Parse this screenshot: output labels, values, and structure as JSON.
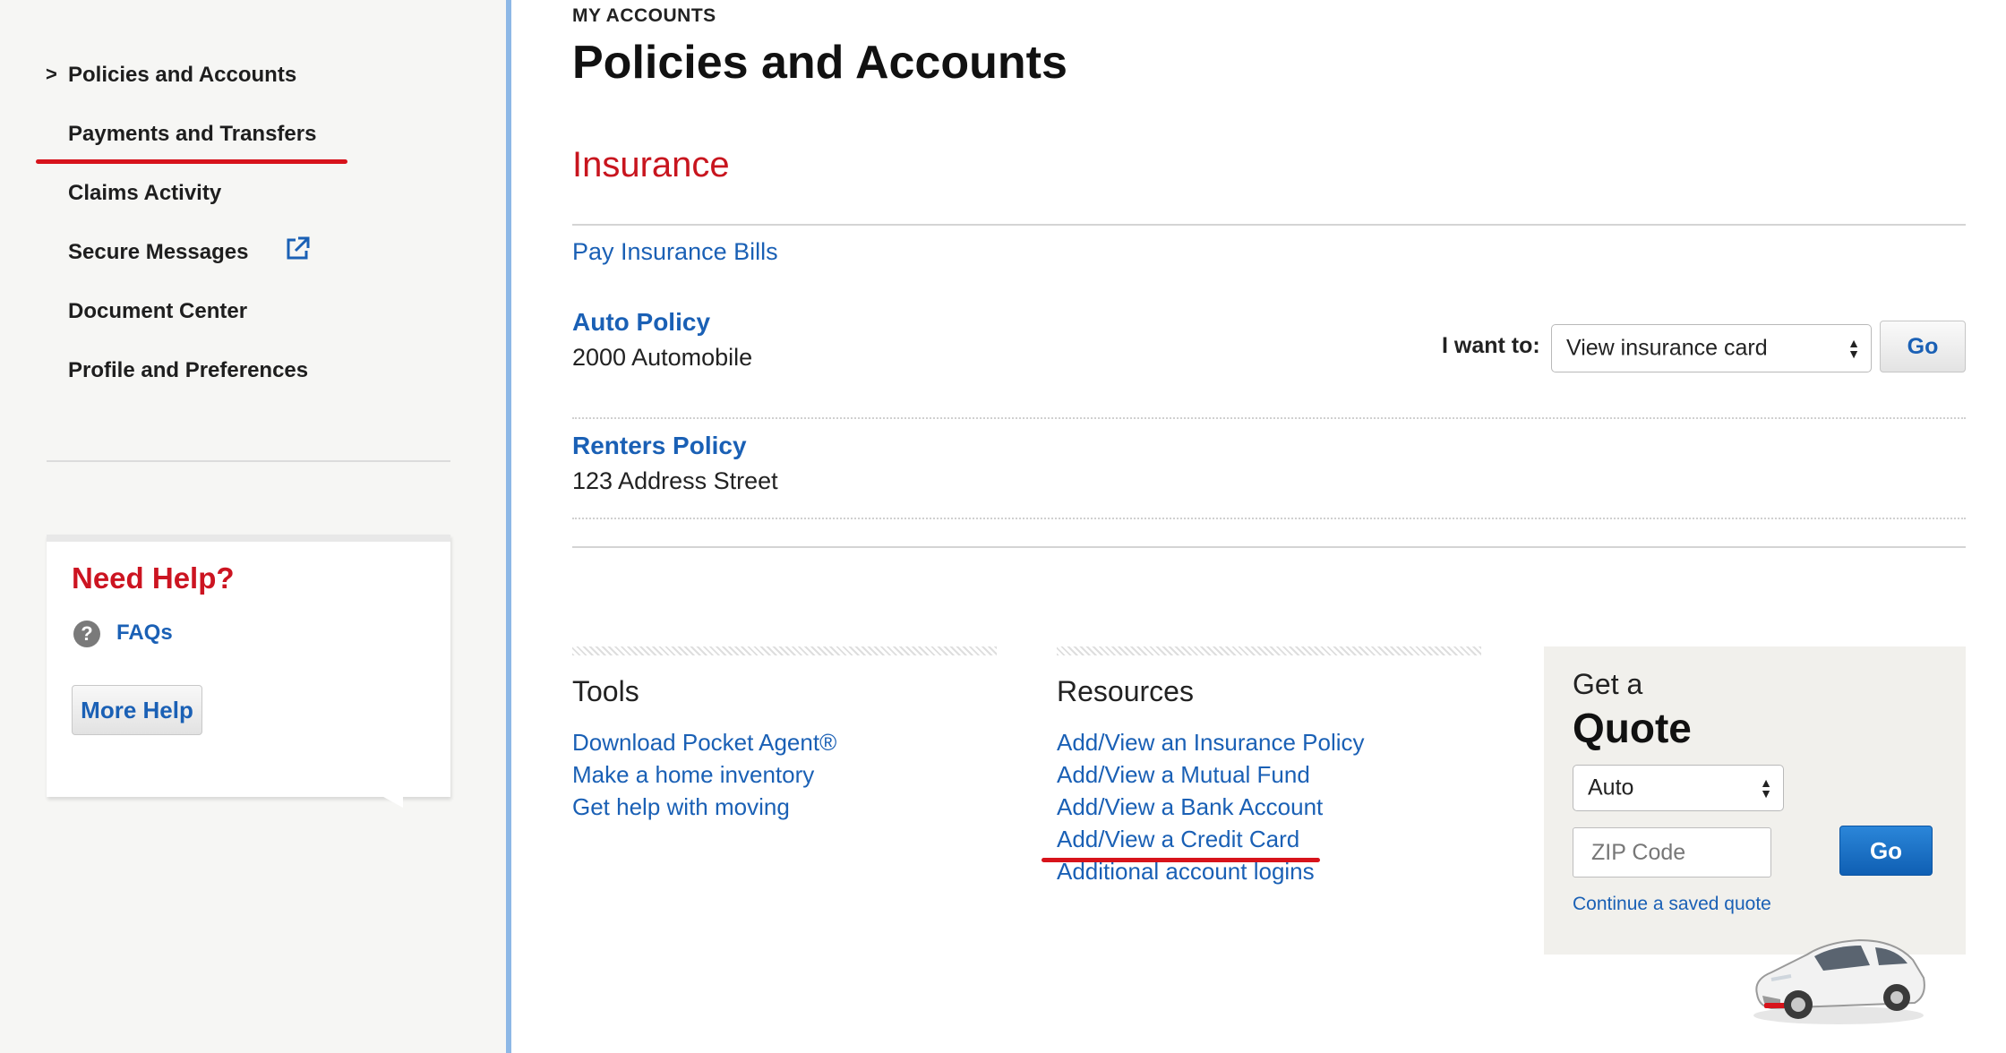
{
  "sidebar": {
    "items": [
      {
        "label": "Policies and Accounts",
        "current": true
      },
      {
        "label": "Payments and Transfers"
      },
      {
        "label": "Claims Activity"
      },
      {
        "label": "Secure Messages"
      },
      {
        "label": "Document Center"
      },
      {
        "label": "Profile and Preferences"
      }
    ],
    "caret": ">",
    "help": {
      "title": "Need Help?",
      "faq_icon_glyph": "?",
      "faq_label": "FAQs",
      "more_help_label": "More Help"
    }
  },
  "header": {
    "eyebrow": "MY ACCOUNTS",
    "title": "Policies and Accounts"
  },
  "insurance": {
    "section_title": "Insurance",
    "pay_bills_label": "Pay Insurance Bills",
    "policies": [
      {
        "title": "Auto Policy",
        "subtitle": "2000 Automobile"
      },
      {
        "title": "Renters Policy",
        "subtitle": "123 Address Street"
      }
    ],
    "action": {
      "label": "I want to:",
      "selected": "View insurance card",
      "go_label": "Go"
    }
  },
  "tools": {
    "title": "Tools",
    "links": [
      "Download Pocket Agent®",
      "Make a home inventory",
      "Get help with moving"
    ]
  },
  "resources": {
    "title": "Resources",
    "links": [
      "Add/View an Insurance Policy",
      "Add/View a Mutual Fund",
      "Add/View a Bank Account",
      "Add/View a Credit Card",
      "Additional account logins"
    ]
  },
  "quote": {
    "small_title": "Get a",
    "big_title": "Quote",
    "product_selected": "Auto",
    "zip_placeholder": "ZIP Code",
    "go_label": "Go",
    "continue_label": "Continue a saved quote"
  },
  "colors": {
    "link_blue": "#1a60b5",
    "brand_red": "#c8151e",
    "annotation_red": "#d7131b",
    "sidebar_border": "#8db8e6"
  },
  "icons": {
    "external_link": "external-link-icon",
    "help": "question-circle-icon",
    "select_arrows": "select-arrows-icon",
    "car": "car-image"
  }
}
